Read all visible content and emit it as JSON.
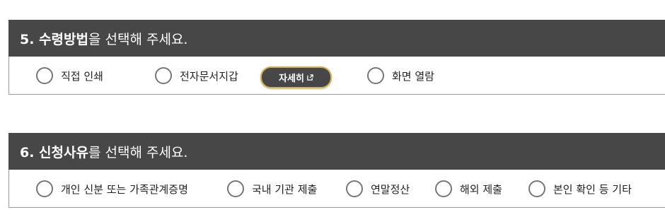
{
  "section5": {
    "title_strong": "5. 수령방법",
    "title_rest": "을 선택해 주세요.",
    "options": [
      {
        "label": "직접 인쇄"
      },
      {
        "label": "전자문서지갑"
      },
      {
        "label": "화면 열람"
      }
    ],
    "detail_button_label": "자세히",
    "detail_button_icon": "external-link-icon",
    "detail_button_border_color": "#d4b24a"
  },
  "section6": {
    "title_strong": "6. 신청사유",
    "title_rest": "를 선택해 주세요.",
    "options": [
      {
        "label": "개인 신분 또는 가족관계증명"
      },
      {
        "label": "국내 기관 제출"
      },
      {
        "label": "연말정산"
      },
      {
        "label": "해외 제출"
      },
      {
        "label": "본인 확인 등 기타"
      }
    ]
  },
  "colors": {
    "header_bg": "#474747",
    "radio_border": "#777777"
  }
}
